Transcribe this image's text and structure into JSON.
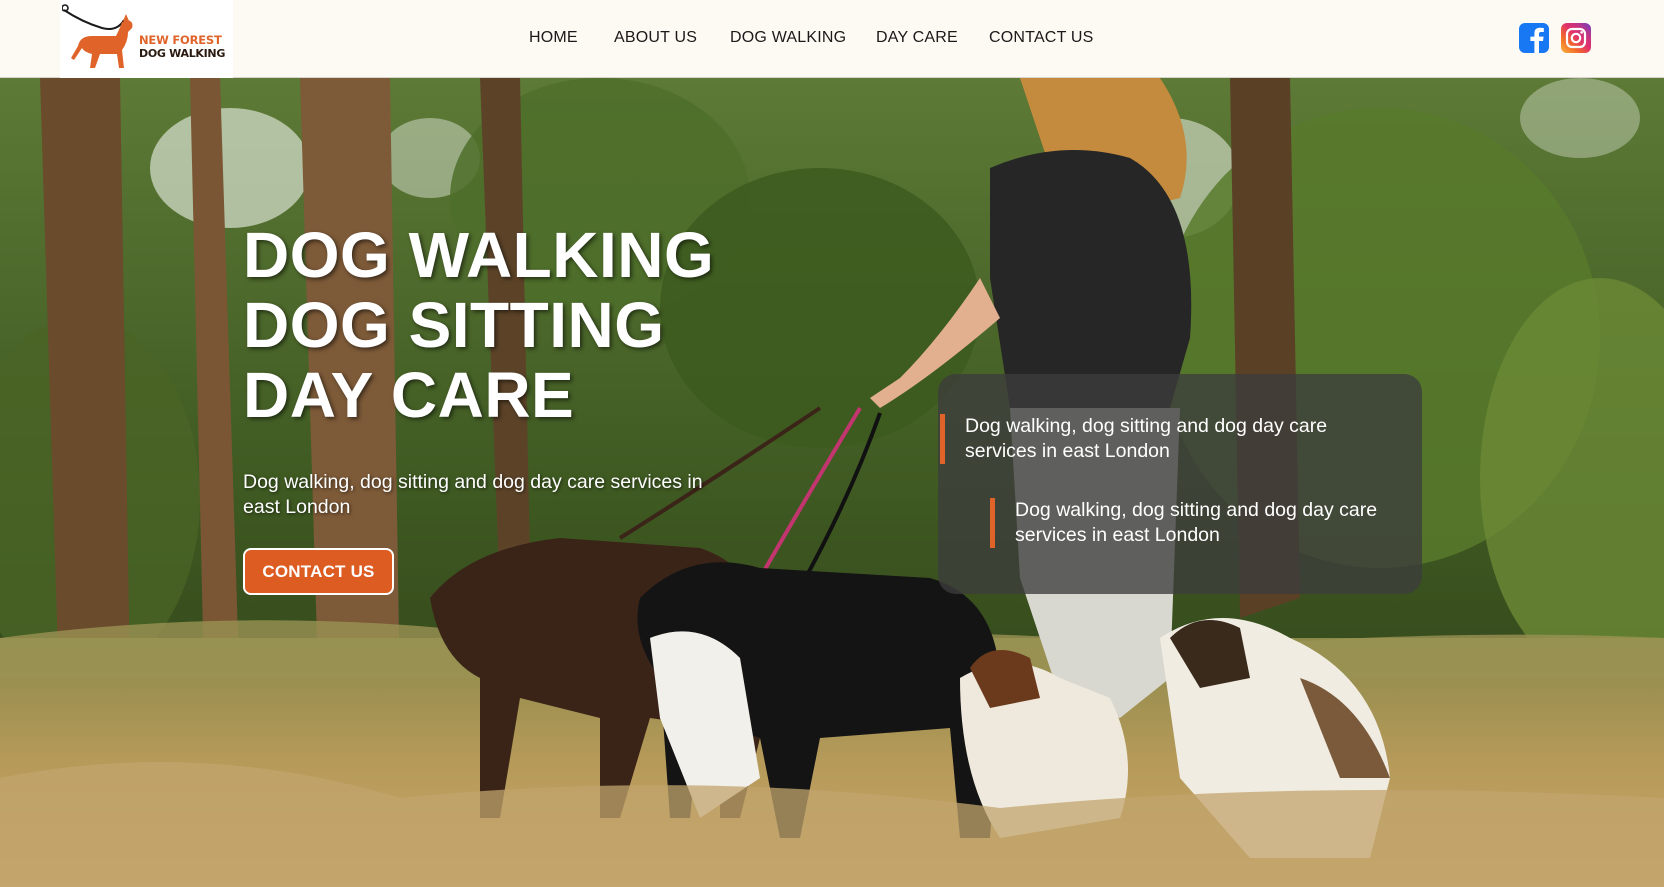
{
  "logo": {
    "line1": "NEW FOREST",
    "line2": "DOG WALKING",
    "icon": "dog-with-leash-logo"
  },
  "nav": {
    "items": [
      {
        "label": "HOME"
      },
      {
        "label": "ABOUT US"
      },
      {
        "label": "DOG WALKING"
      },
      {
        "label": "DAY CARE"
      },
      {
        "label": "CONTACT US"
      }
    ]
  },
  "social": {
    "facebook_icon": "facebook-icon",
    "instagram_icon": "instagram-icon"
  },
  "hero": {
    "title_lines": [
      "DOG WALKING",
      "DOG SITTING",
      "DAY CARE"
    ],
    "subtitle": "Dog walking, dog sitting and dog day care services in east London",
    "cta_label": "CONTACT US",
    "quote_1": "Dog walking, dog sitting and dog day care services in east London",
    "quote_2": "Dog walking, dog sitting and dog day care services in east London"
  },
  "colors": {
    "accent": "#dd5c22",
    "header_bg": "#fdf9f3",
    "facebook": "#1877f2"
  }
}
